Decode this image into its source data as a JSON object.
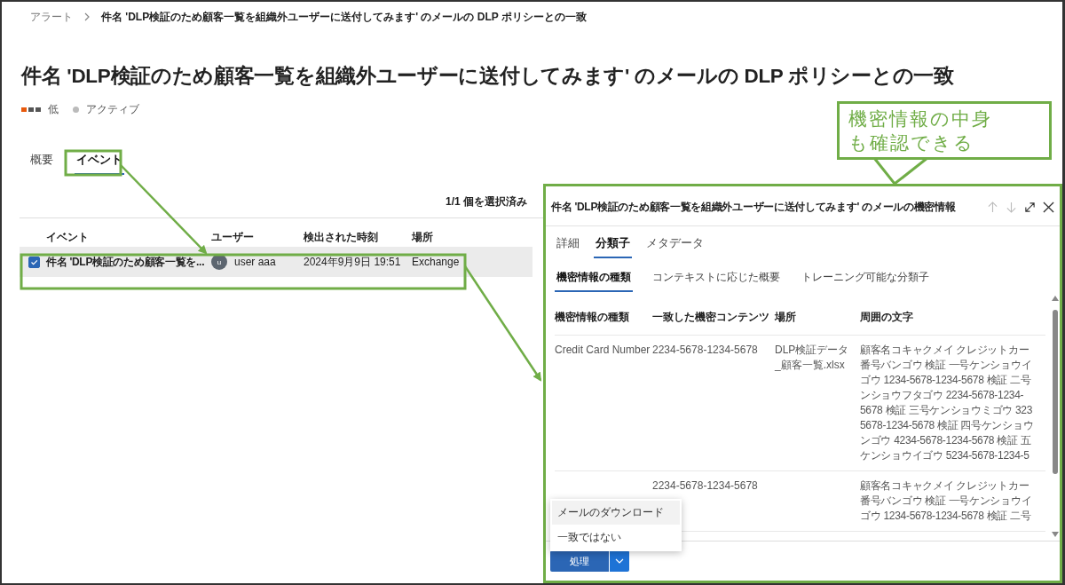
{
  "breadcrumb": [
    {
      "label": "アラート"
    },
    {
      "label": "件名 'DLP検証のため顧客一覧を組織外ユーザーに送付してみます' のメールの DLP ポリシーとの一致"
    }
  ],
  "page_title": "件名 'DLP検証のため顧客一覧を組織外ユーザーに送付してみます' のメールの DLP ポリシーとの一致",
  "severity": {
    "label": "低",
    "level": 0.33
  },
  "status": {
    "label": "アクティブ"
  },
  "tabs": [
    {
      "label": "概要",
      "selected": false
    },
    {
      "label": "イベント",
      "selected": true
    }
  ],
  "selection_count": "1/1 個を選択済み",
  "table": {
    "columns": [
      "イベント",
      "ユーザー",
      "検出された時刻",
      "場所"
    ],
    "rows": [
      {
        "selected": true,
        "event": "件名 'DLP検証のため顧客一覧を...",
        "user_initial": "u",
        "user": "user aaa",
        "detected": "2024年9月9日 19:51",
        "location": "Exchange"
      }
    ]
  },
  "panel": {
    "title": "件名 'DLP検証のため顧客一覧を組織外ユーザーに送付してみます' のメールの機密情報",
    "tabs": [
      {
        "label": "詳細",
        "selected": false
      },
      {
        "label": "分類子",
        "selected": true
      },
      {
        "label": "メタデータ",
        "selected": false
      }
    ],
    "subtabs": [
      {
        "label": "機密情報の種類",
        "selected": true
      },
      {
        "label": "コンテキストに応じた概要",
        "selected": false
      },
      {
        "label": "トレーニング可能な分類子",
        "selected": false
      }
    ],
    "table": {
      "columns": [
        "機密情報の種類",
        "一致した機密コンテンツ",
        "場所",
        "周囲の文字"
      ],
      "rows": [
        {
          "type": "Credit Card Number",
          "content": "2234-5678-1234-5678",
          "location": "DLP検証データ_顧客一覧.xlsx",
          "context_lines": [
            "顧客名コキャクメイ クレジットカー",
            "番号バンゴウ 検証 一号ケンショウイ",
            "ゴウ 1234-5678-1234-5678 検証 二号",
            "ンショウフタゴウ 2234-5678-1234-",
            "5678 検証 三号ケンショウミゴウ 323",
            "5678-1234-5678 検証 四号ケンショウ",
            "ンゴウ 4234-5678-1234-5678 検証 五",
            "ケンショウイゴウ 5234-5678-1234-5"
          ]
        },
        {
          "content": "2234-5678-1234-5678",
          "context_lines": [
            "顧客名コキャクメイ クレジットカー",
            "番号バンゴウ 検証 一号ケンショウイ",
            "ゴウ 1234-5678-1234-5678 検証 二号"
          ]
        }
      ]
    },
    "menu": [
      {
        "label": "メールのダウンロード",
        "selected": true
      },
      {
        "label": "一致ではない",
        "selected": false
      }
    ],
    "action_button": {
      "label": "処理"
    }
  },
  "callout": {
    "lines": [
      "機密情報の中身",
      "も確認できる"
    ]
  }
}
